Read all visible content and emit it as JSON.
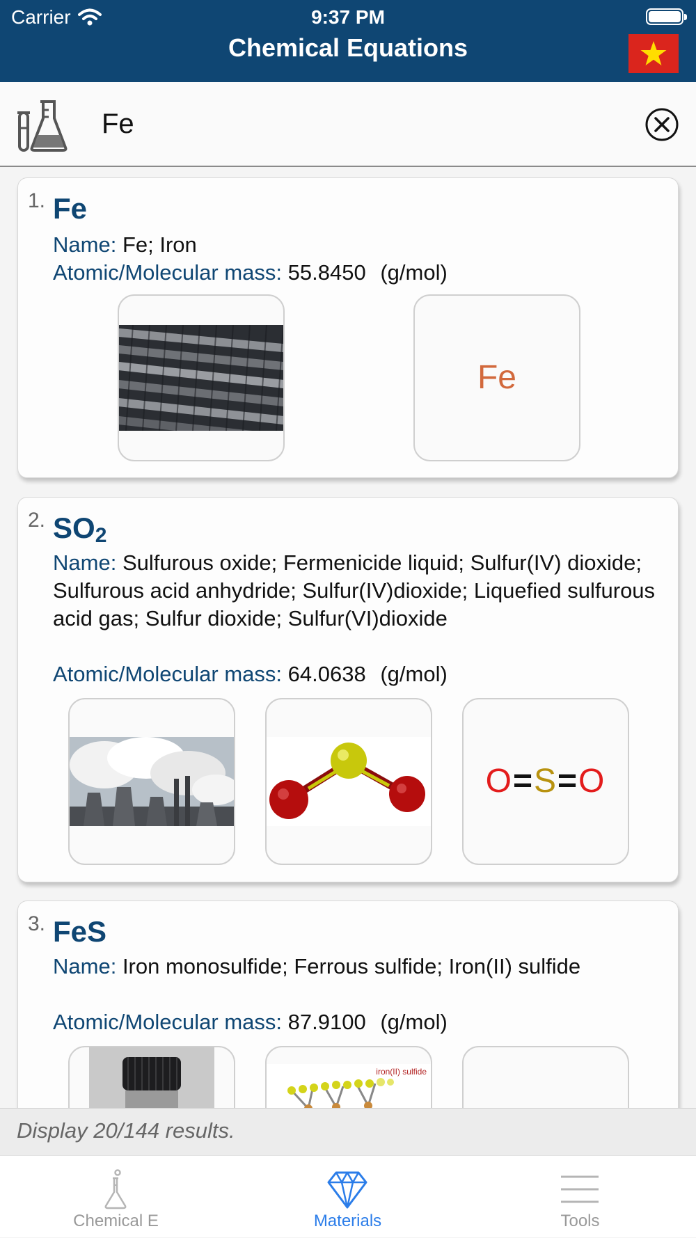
{
  "status_bar": {
    "carrier": "Carrier",
    "time": "9:37 PM"
  },
  "header": {
    "title": "Chemical Equations",
    "language_flag": "vietnam-flag-icon"
  },
  "search": {
    "query": "Fe",
    "left_icon": "flask-icon",
    "clear_icon": "close-circle-icon"
  },
  "labels": {
    "name": "Name:",
    "mass": "Atomic/Molecular mass:",
    "unit": "(g/mol)"
  },
  "results": [
    {
      "index": "1.",
      "formula": "Fe",
      "name_value": "Fe; Iron",
      "mass_value": "55.8450",
      "images": [
        "steel-rebars-photo",
        "Fe"
      ]
    },
    {
      "index": "2.",
      "formula_main": "SO",
      "formula_sub": "2",
      "name_value": "Sulfurous oxide; Fermenicide liquid; Sulfur(IV) dioxide; Sulfurous acid anhydride; Sulfur(IV)dioxide; Liquefied sulfurous acid gas; Sulfur dioxide; Sulfur(VI)dioxide",
      "mass_value": "64.0638",
      "structure": {
        "o1": "O",
        "eq1": "=",
        "s": "S",
        "eq2": "=",
        "o2": "O"
      },
      "images": [
        "power-plant-smoke-photo",
        "ball-and-stick-model",
        "structural-formula"
      ]
    },
    {
      "index": "3.",
      "formula": "FeS",
      "name_value": "Iron monosulfide; Ferrous sulfide; Iron(II) sulfide",
      "mass_value": "87.9100",
      "model_caption": "iron(II) sulfide",
      "images": [
        "reagent-bottle-photo",
        "crystal-structure-model",
        "blank"
      ]
    }
  ],
  "footer": {
    "display_text": "Display 20/144 results."
  },
  "tabs": [
    {
      "label": "Chemical E",
      "icon": "flask-outline-icon",
      "active": false
    },
    {
      "label": "Materials",
      "icon": "diamond-icon",
      "active": true
    },
    {
      "label": "Tools",
      "icon": "menu-lines-icon",
      "active": false
    }
  ],
  "colors": {
    "primary": "#0f4673",
    "active_tab": "#2b7de9",
    "fe_label": "#d2693c",
    "oxygen": "#e31c1c",
    "sulfur": "#b8920f"
  }
}
